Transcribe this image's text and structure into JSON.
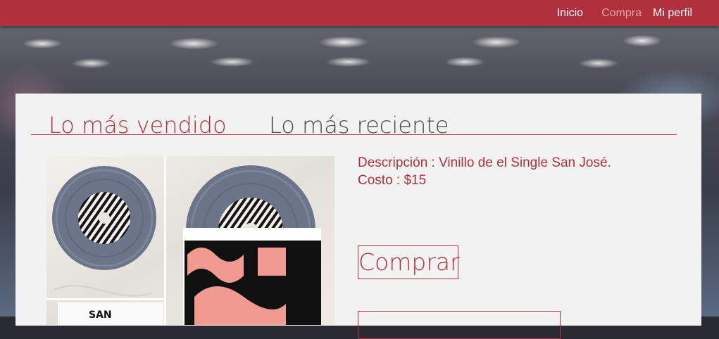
{
  "nav": {
    "inicio": "Inicio",
    "compra": "Compra",
    "perfil": "Mi perfil"
  },
  "tabs": {
    "mas_vendido": "Lo más vendido",
    "mas_reciente": "Lo más reciente"
  },
  "product": {
    "descripcion": "Descripción : Vinillo de el Single San José.",
    "costo": "Costo : $15",
    "sleeve_text": "SAN",
    "comprar_label": "Comprar"
  },
  "colors": {
    "brand": "#b0303d",
    "panel": "#f2f2f2"
  }
}
